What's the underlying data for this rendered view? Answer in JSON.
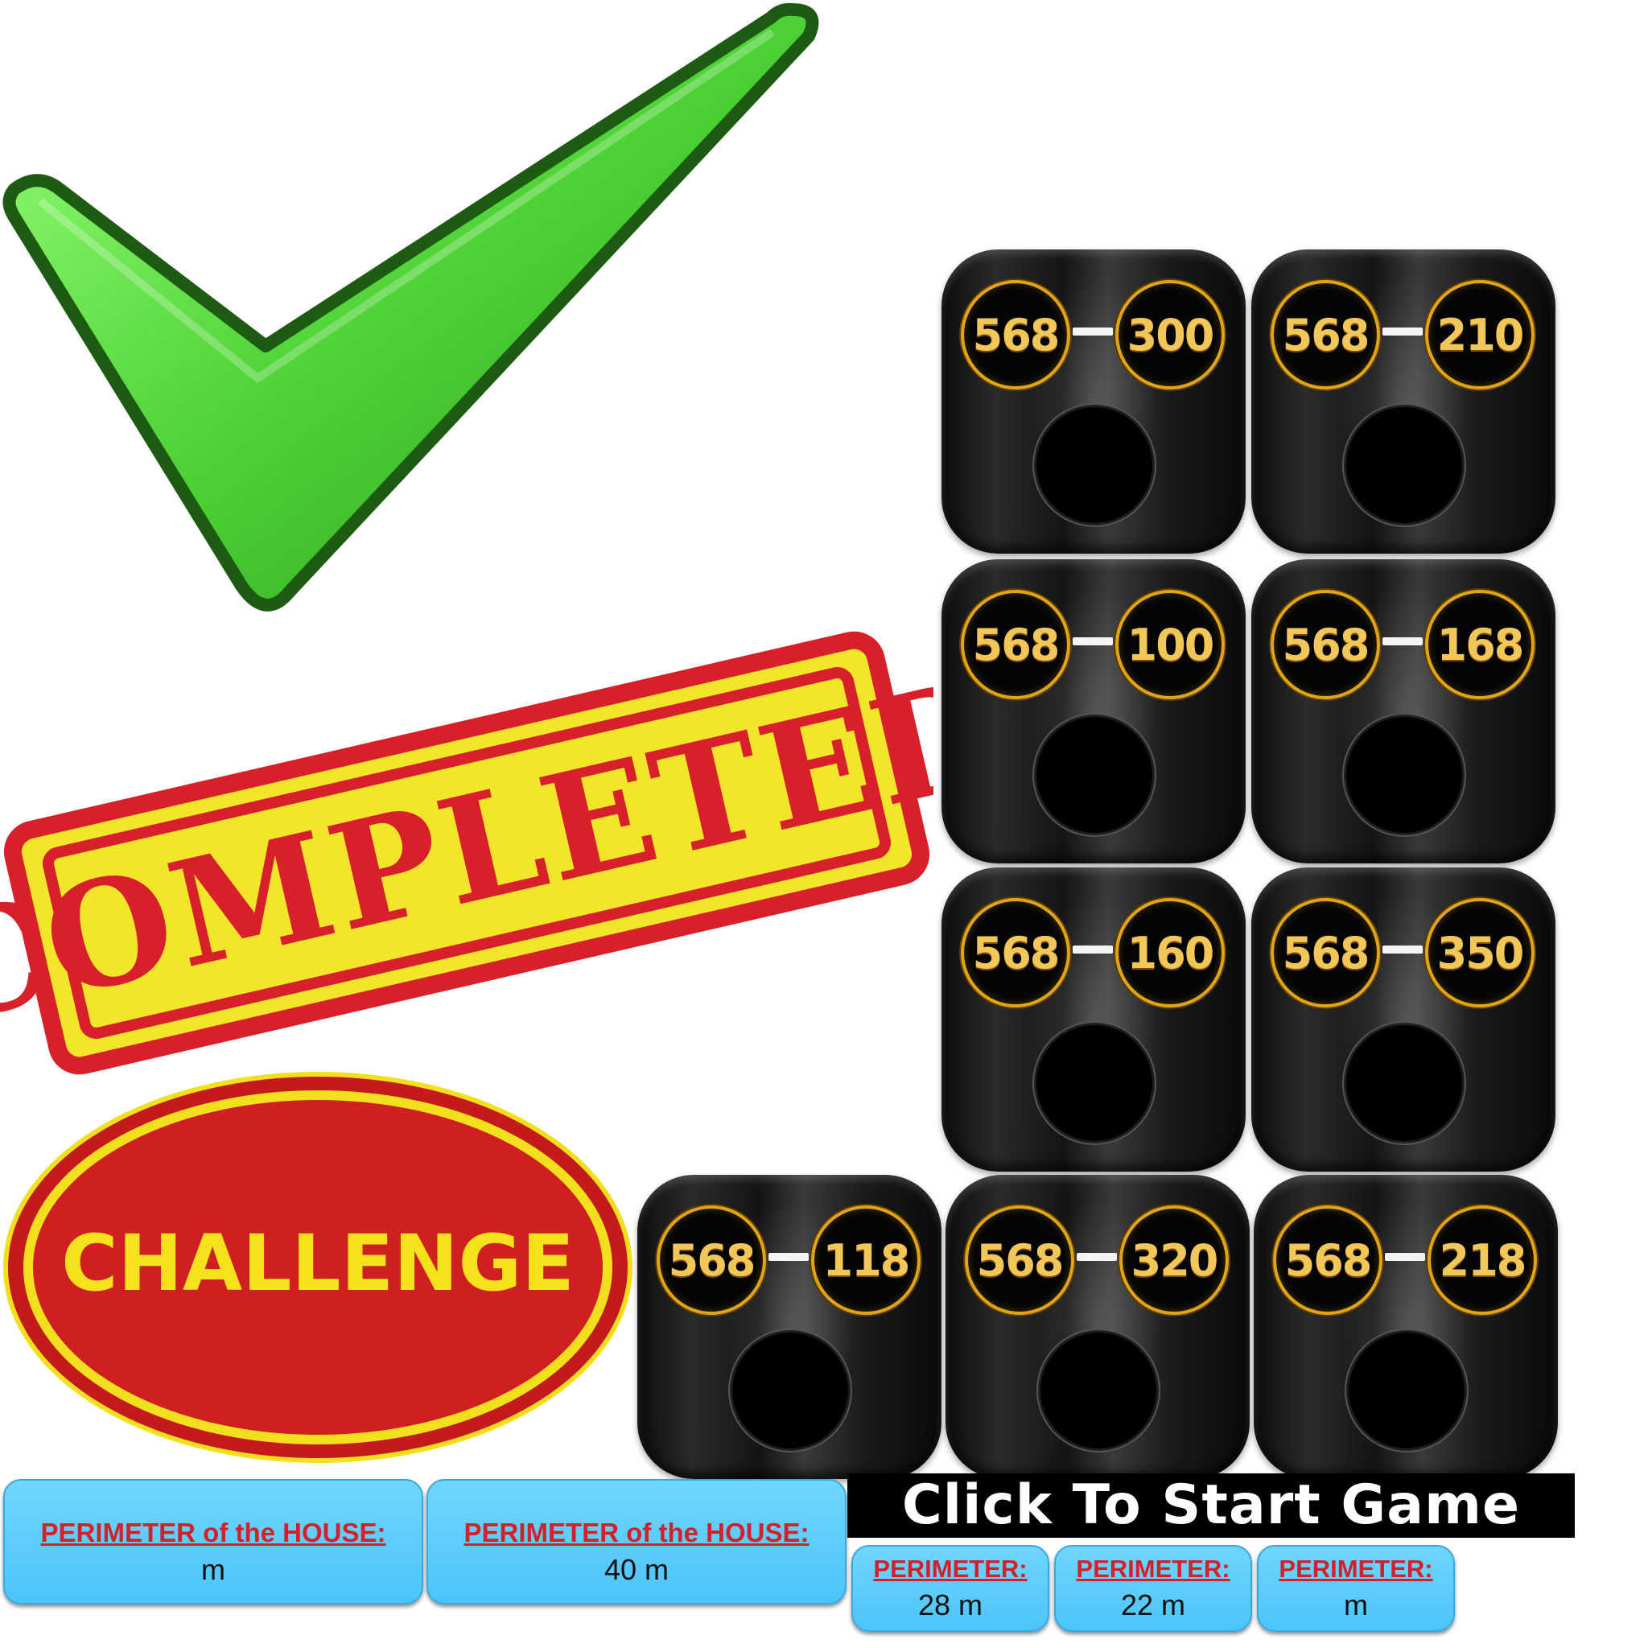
{
  "start_button": {
    "label": "Click To Start Game"
  },
  "stamps": {
    "completed": "COMPLETED",
    "challenge": "CHALLENGE"
  },
  "tiles": [
    {
      "a": "568",
      "b": "300"
    },
    {
      "a": "568",
      "b": "210"
    },
    {
      "a": "568",
      "b": "100"
    },
    {
      "a": "568",
      "b": "168"
    },
    {
      "a": "568",
      "b": "160"
    },
    {
      "a": "568",
      "b": "350"
    },
    {
      "a": "568",
      "b": "118"
    },
    {
      "a": "568",
      "b": "320"
    },
    {
      "a": "568",
      "b": "218"
    }
  ],
  "house_cards": [
    {
      "label": "PERIMETER of the HOUSE:",
      "value": "m"
    },
    {
      "label": "PERIMETER of the HOUSE:",
      "value": "40 m"
    }
  ],
  "perimeter_cards": [
    {
      "label": "PERIMETER:",
      "value": "28 m"
    },
    {
      "label": "PERIMETER:",
      "value": "22 m"
    },
    {
      "label": "PERIMETER:",
      "value": "m"
    }
  ],
  "colors": {
    "check_green": "#4fd33a",
    "stamp_red": "#d8202a",
    "stamp_yellow": "#f6e726",
    "card_blue": "#57c9fb",
    "gold": "#e0a416"
  }
}
